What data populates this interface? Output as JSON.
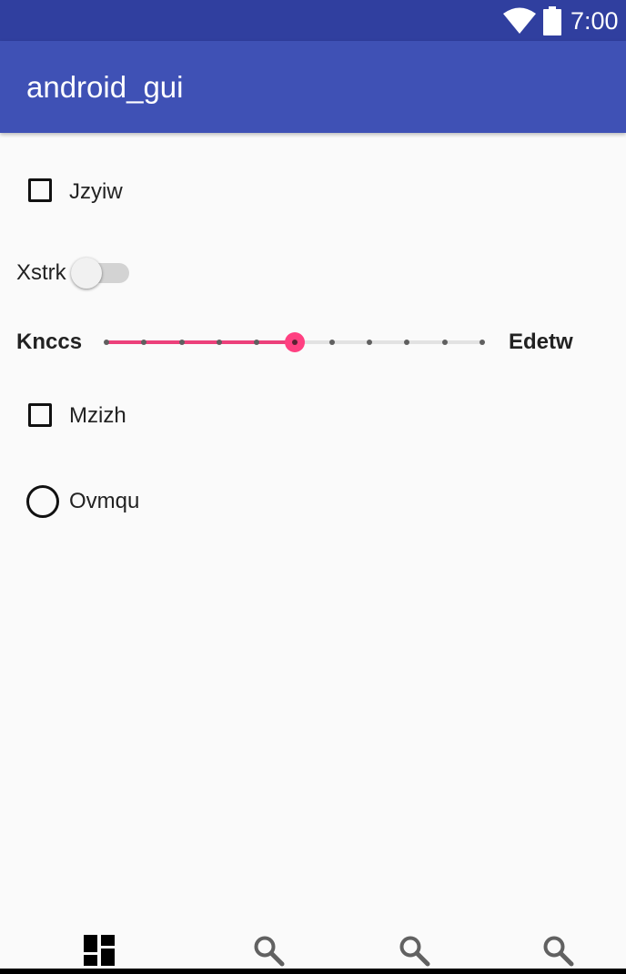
{
  "status_bar": {
    "time": "7:00",
    "wifi_icon": "wifi-icon",
    "battery_icon": "battery-icon",
    "background": "#303f9f"
  },
  "app_bar": {
    "title": "android_gui",
    "background": "#3f51b5"
  },
  "content": {
    "checkbox_1": {
      "label": "Jzyiw",
      "checked": false
    },
    "switch_1": {
      "label": "Xstrk",
      "on": false
    },
    "slider_1": {
      "start_label": "Knccs",
      "end_label": "Edetw",
      "min": 0,
      "max": 10,
      "value": 5,
      "accent": "#ff4081"
    },
    "checkbox_2": {
      "label": "Mzizh",
      "checked": false
    },
    "radio_1": {
      "label": "Ovmqu",
      "selected": false
    }
  },
  "bottom_nav": {
    "items": [
      {
        "icon": "dashboard-icon",
        "selected": true
      },
      {
        "icon": "search-icon",
        "selected": false
      },
      {
        "icon": "search-icon",
        "selected": false
      },
      {
        "icon": "search-icon",
        "selected": false
      }
    ]
  }
}
